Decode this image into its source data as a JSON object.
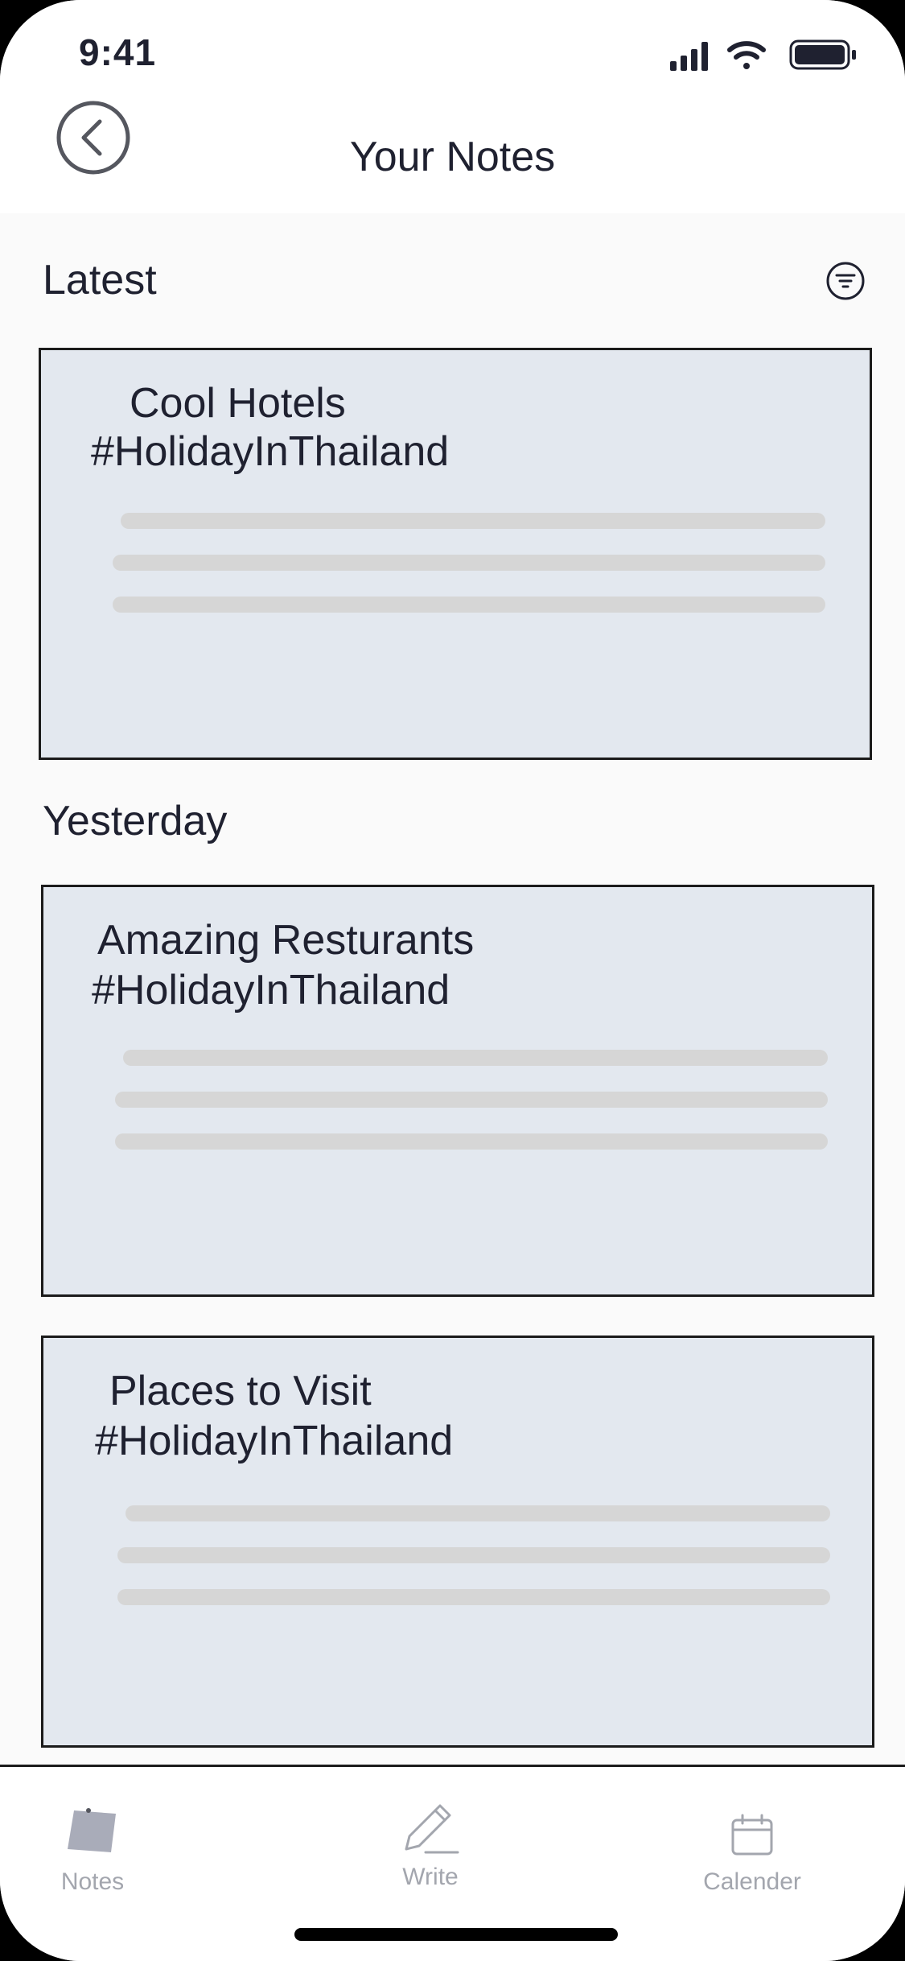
{
  "status_bar": {
    "time": "9:41"
  },
  "header": {
    "title": "Your Notes",
    "back_icon": "chevron-left-circle-icon"
  },
  "sections": {
    "latest_label": "Latest",
    "yesterday_label": "Yesterday",
    "filter_icon": "filter-icon"
  },
  "notes": [
    {
      "title": "Cool Hotels",
      "tag": "#HolidayInThailand"
    },
    {
      "title": "Amazing Resturants",
      "tag": "#HolidayInThailand"
    },
    {
      "title": "Places to Visit",
      "tag": "#HolidayInThailand"
    }
  ],
  "tabbar": {
    "items": [
      {
        "label": "Notes",
        "icon": "note-icon",
        "active": true
      },
      {
        "label": "Write",
        "icon": "pen-icon",
        "active": false
      },
      {
        "label": "Calender",
        "icon": "calendar-icon",
        "active": false
      }
    ]
  },
  "colors": {
    "card_bg": "#e3e8ef",
    "text": "#1f2130",
    "tab_inactive": "#a3a6ae",
    "placeholder": "#d6d6d6"
  }
}
